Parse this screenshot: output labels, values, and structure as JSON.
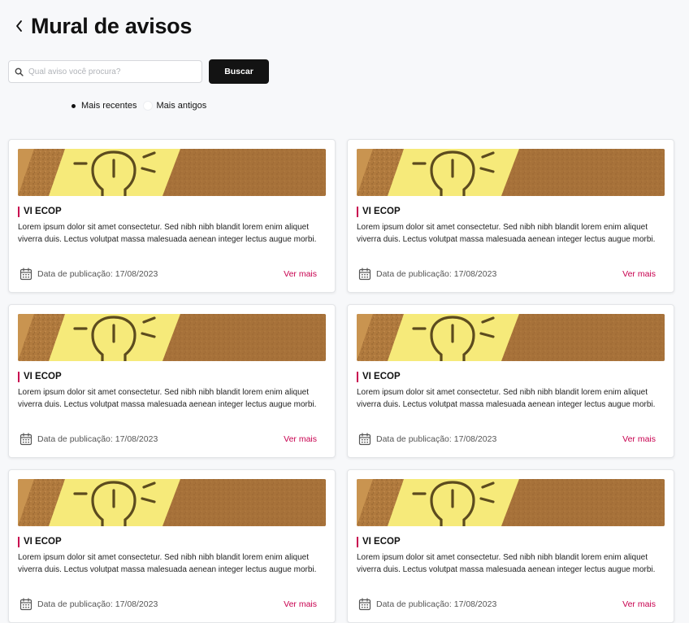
{
  "header": {
    "title": "Mural de avisos"
  },
  "search": {
    "placeholder": "Qual aviso você procura?",
    "value": "",
    "button_label": "Buscar"
  },
  "sort": {
    "options": [
      {
        "label": "Mais recentes",
        "selected": true
      },
      {
        "label": "Mais antigos",
        "selected": false
      }
    ]
  },
  "cards": [
    {
      "title": "VI ECOP",
      "description": "Lorem ipsum dolor sit amet consectetur. Sed nibh nibh blandit lorem enim aliquet viverra duis. Lectus volutpat massa malesuada aenean integer lectus augue morbi.",
      "date_label": "Data de publicação: 17/08/2023",
      "more_label": "Ver mais"
    },
    {
      "title": "VI ECOP",
      "description": "Lorem ipsum dolor sit amet consectetur. Sed nibh nibh blandit lorem enim aliquet viverra duis. Lectus volutpat massa malesuada aenean integer lectus augue morbi.",
      "date_label": "Data de publicação: 17/08/2023",
      "more_label": "Ver mais"
    },
    {
      "title": "VI ECOP",
      "description": "Lorem ipsum dolor sit amet consectetur. Sed nibh nibh blandit lorem enim aliquet viverra duis. Lectus volutpat massa malesuada aenean integer lectus augue morbi.",
      "date_label": "Data de publicação: 17/08/2023",
      "more_label": "Ver mais"
    },
    {
      "title": "VI ECOP",
      "description": "Lorem ipsum dolor sit amet consectetur. Sed nibh nibh blandit lorem enim aliquet viverra duis. Lectus volutpat massa malesuada aenean integer lectus augue morbi.",
      "date_label": "Data de publicação: 17/08/2023",
      "more_label": "Ver mais"
    },
    {
      "title": "VI ECOP",
      "description": "Lorem ipsum dolor sit amet consectetur. Sed nibh nibh blandit lorem enim aliquet viverra duis. Lectus volutpat massa malesuada aenean integer lectus augue morbi.",
      "date_label": "Data de publicação: 17/08/2023",
      "more_label": "Ver mais"
    },
    {
      "title": "VI ECOP",
      "description": "Lorem ipsum dolor sit amet consectetur. Sed nibh nibh blandit lorem enim aliquet viverra duis. Lectus volutpat massa malesuada aenean integer lectus augue morbi.",
      "date_label": "Data de publicação: 17/08/2023",
      "more_label": "Ver mais"
    }
  ],
  "colors": {
    "accent": "#c8004f",
    "button_bg": "#131313",
    "page_bg": "#f7f8fa",
    "cork": "#b07a3e",
    "sticky_note": "#f6ea7a"
  },
  "icons": {
    "back": "chevron-left-icon",
    "search": "magnifier-icon",
    "date": "calendar-icon"
  }
}
